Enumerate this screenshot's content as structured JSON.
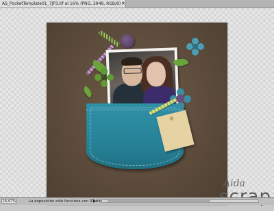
{
  "document_tab": {
    "title": "AS_PocketTemplate01_7JP3.tif al 16% (PNG, 2948, RGB/8) *",
    "close_symbol": "×"
  },
  "watermark": {
    "script_text": "Aida",
    "main_text": "scrap"
  },
  "status_bar": {
    "zoom": "16,67%",
    "message": "La exposición sólo funciona con 32 bits",
    "arrow": "▶"
  },
  "colors": {
    "background_paper": "#5b4a3a",
    "pocket": "#2f91a6",
    "tag": "#e6d3a4",
    "button": "#5b4268"
  }
}
